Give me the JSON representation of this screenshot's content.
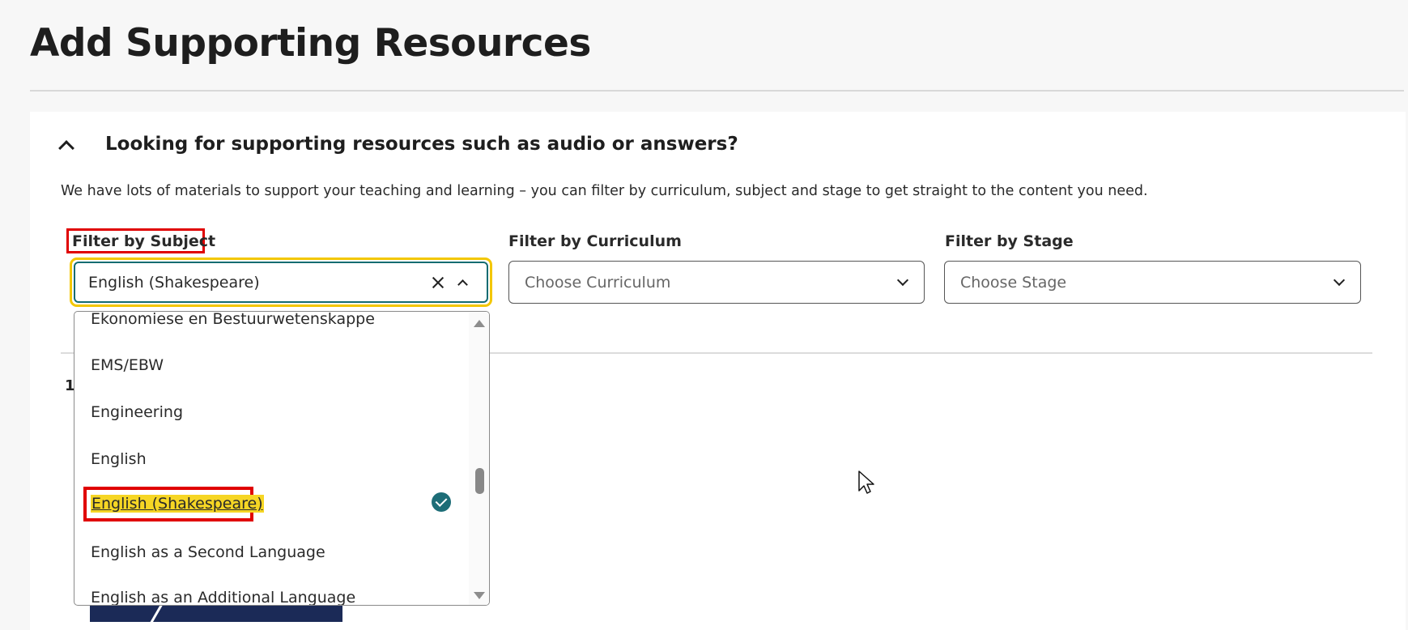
{
  "page": {
    "title": "Add Supporting Resources"
  },
  "accordion": {
    "title": "Looking for supporting resources such as audio or answers?",
    "intro": "We have lots of materials to support your teaching and learning – you can filter by curriculum, subject and stage to get straight to the content you need."
  },
  "filters": {
    "subject": {
      "label": "Filter by Subject",
      "value": "English (Shakespeare)"
    },
    "curriculum": {
      "label": "Filter by Curriculum",
      "placeholder": "Choose Curriculum"
    },
    "stage": {
      "label": "Filter by Stage",
      "placeholder": "Choose Stage"
    }
  },
  "results": {
    "count_fragment": "1"
  },
  "subject_options": [
    "Ekonomiese en Bestuurwetenskappe",
    "EMS/EBW",
    "Engineering",
    "English",
    "English (Shakespeare)",
    "English as a Second Language",
    "English as an Additional Language"
  ],
  "colors": {
    "focus_ring": "#f3c700",
    "select_border": "#136c72",
    "annotation_red": "#e00000",
    "selected_bg": "#f6d624",
    "check": "#1d6d77"
  }
}
